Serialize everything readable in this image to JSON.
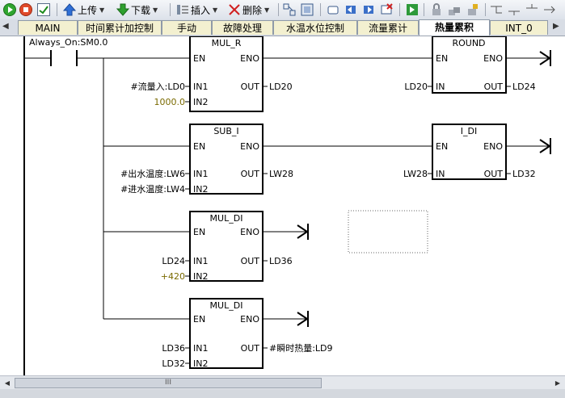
{
  "toolbar": {
    "upload_label": "上传",
    "download_label": "下载",
    "insert_label": "插入",
    "delete_label": "删除"
  },
  "tabs": [
    "MAIN",
    "时间累计加控制",
    "手动",
    "故障处理",
    "水温水位控制",
    "流量累计",
    "热量累积",
    "INT_0"
  ],
  "active_tab": "热量累积",
  "ladder": {
    "contact_label": "Always_On:SM0.0",
    "blocks": {
      "mul_r": {
        "name": "MUL_R",
        "en": "EN",
        "eno": "ENO",
        "in1_pin": "IN1",
        "in2_pin": "IN2",
        "out_pin": "OUT",
        "in1": "#流量入:LD0",
        "in2": "1000.0",
        "out": "LD20"
      },
      "round": {
        "name": "ROUND",
        "en": "EN",
        "eno": "ENO",
        "in_pin": "IN",
        "out_pin": "OUT",
        "in": "LD20",
        "out": "LD24"
      },
      "sub_i": {
        "name": "SUB_I",
        "en": "EN",
        "eno": "ENO",
        "in1_pin": "IN1",
        "in2_pin": "IN2",
        "out_pin": "OUT",
        "in1": "#出水温度:LW6",
        "in2": "#进水温度:LW4",
        "out": "LW28"
      },
      "i_di": {
        "name": "I_DI",
        "en": "EN",
        "eno": "ENO",
        "in_pin": "IN",
        "out_pin": "OUT",
        "in": "LW28",
        "out": "LD32"
      },
      "mul_di_1": {
        "name": "MUL_DI",
        "en": "EN",
        "eno": "ENO",
        "in1_pin": "IN1",
        "in2_pin": "IN2",
        "out_pin": "OUT",
        "in1": "LD24",
        "in2": "+420",
        "out": "LD36"
      },
      "mul_di_2": {
        "name": "MUL_DI",
        "en": "EN",
        "eno": "ENO",
        "in1_pin": "IN1",
        "in2_pin": "IN2",
        "out_pin": "OUT",
        "in1": "LD36",
        "in2": "LD32",
        "out": "#瞬时热量:LD9"
      }
    }
  },
  "hscroll": {
    "grip": "III"
  },
  "colors": {
    "constant": "#7a6a00",
    "wire": "#000000",
    "tab_bg": "#f3f0d0",
    "active_tab_bg": "#ffffff"
  }
}
